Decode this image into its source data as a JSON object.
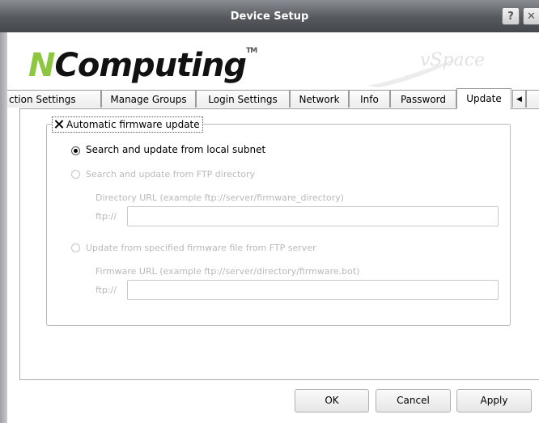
{
  "window": {
    "title": "Device Setup",
    "help_glyph": "?",
    "close_glyph": "✕"
  },
  "brand": {
    "n": "N",
    "rest": "Computing",
    "tm": "TM",
    "vspace": "vSpace"
  },
  "tabs": [
    {
      "label": "ction Settings",
      "active": false
    },
    {
      "label": "Manage Groups",
      "active": false
    },
    {
      "label": "Login Settings",
      "active": false
    },
    {
      "label": "Network",
      "active": false
    },
    {
      "label": "Info",
      "active": false
    },
    {
      "label": "Password",
      "active": false
    },
    {
      "label": "Update",
      "active": true
    }
  ],
  "tab_scroll": {
    "left_glyph": "◀"
  },
  "update": {
    "auto_update": {
      "label": "Automatic firmware update",
      "checked": true
    },
    "options": [
      {
        "label": "Search and update from local subnet",
        "selected": true,
        "enabled": true
      },
      {
        "label": "Search and update from FTP directory",
        "selected": false,
        "enabled": false
      },
      {
        "label": "Update from specified firmware file from FTP server",
        "selected": false,
        "enabled": false
      }
    ],
    "directory_url": {
      "hint": "Directory URL (example ftp://server/firmware_directory)",
      "prefix": "ftp://",
      "value": ""
    },
    "firmware_url": {
      "hint": "Firmware URL (example ftp://server/directory/firmware.bot)",
      "prefix": "ftp://",
      "value": ""
    }
  },
  "buttons": {
    "ok": "OK",
    "cancel": "Cancel",
    "apply": "Apply"
  }
}
